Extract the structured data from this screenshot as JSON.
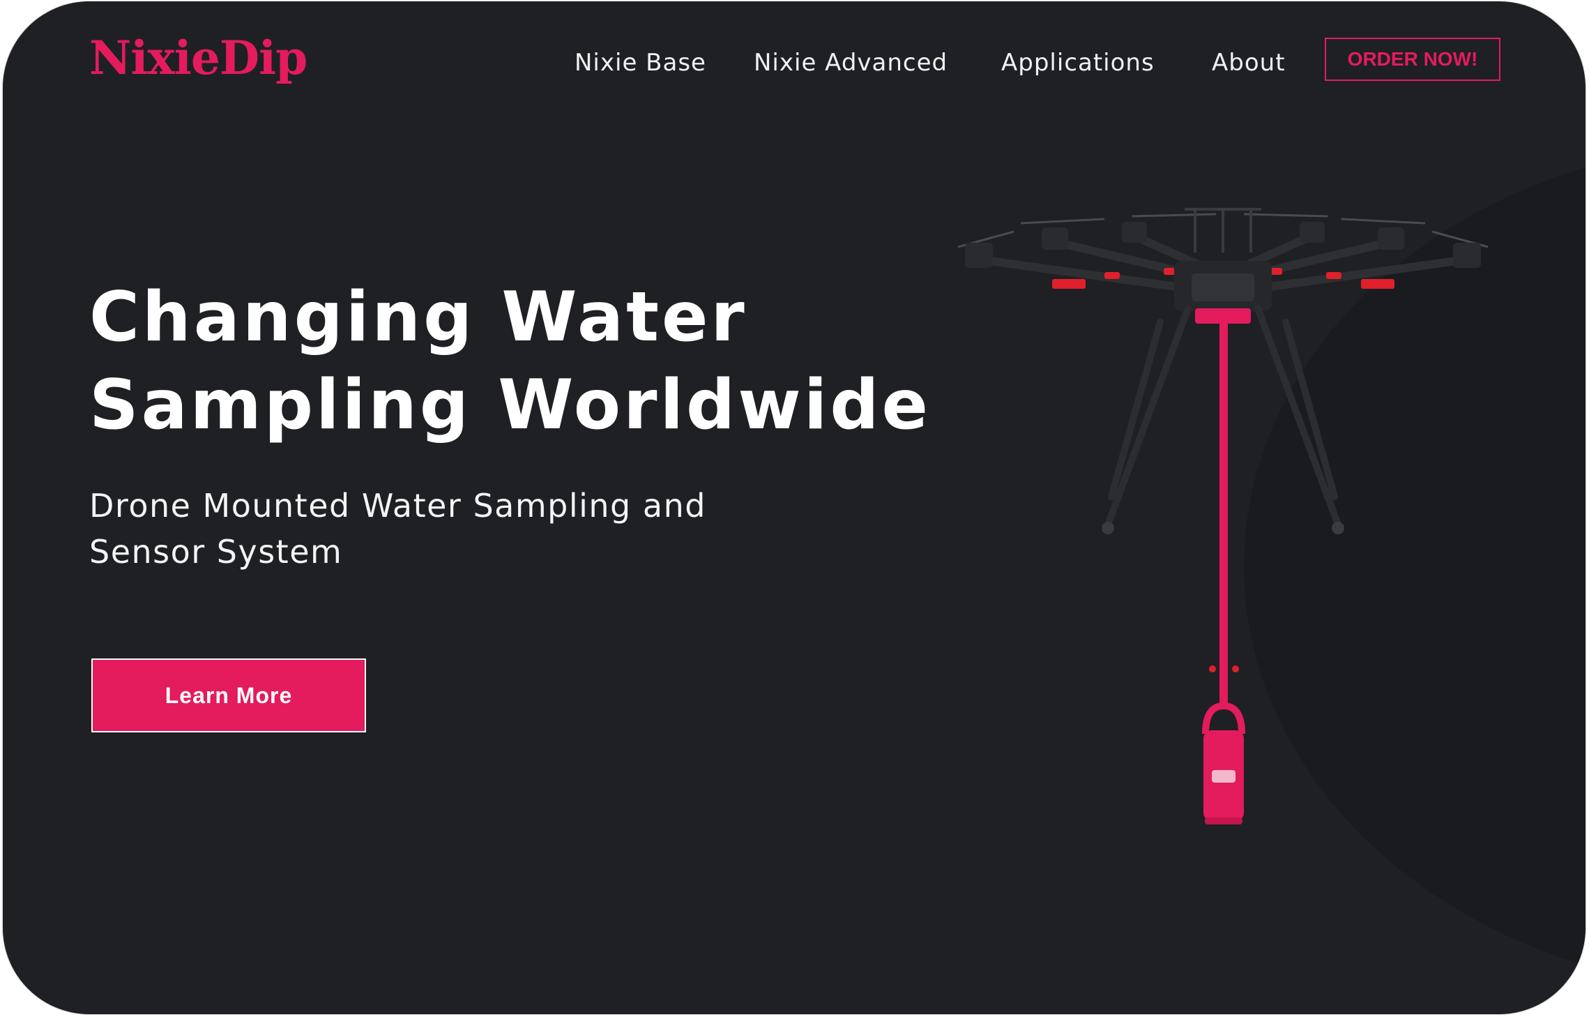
{
  "brand": {
    "logo_text": "NixieDip",
    "accent_color": "#e41b5d",
    "background_color": "#1f2024"
  },
  "nav": {
    "items": [
      {
        "label": "Nixie Base"
      },
      {
        "label": "Nixie Advanced"
      },
      {
        "label": "Applications"
      },
      {
        "label": "About"
      }
    ],
    "cta_label": "ORDER NOW!"
  },
  "hero": {
    "headline_lines": [
      "Changing Water",
      "Sampling Worldwide"
    ],
    "subtitle_lines": [
      "Drone Mounted Water Sampling and",
      "Sensor System"
    ],
    "button_label": "Learn More",
    "image": "drone-with-water-sampler"
  }
}
